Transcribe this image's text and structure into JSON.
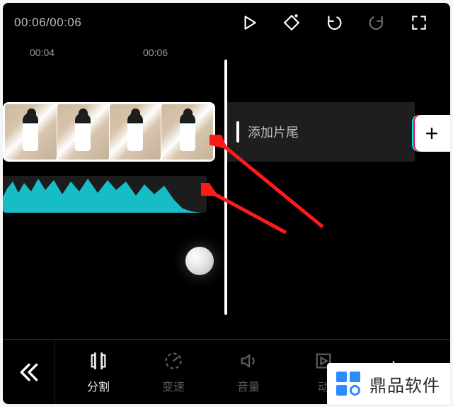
{
  "topbar": {
    "time_current": "00:06",
    "time_total": "00:06"
  },
  "ruler": {
    "marks": [
      "00:04",
      "00:06"
    ]
  },
  "end_slate": {
    "label": "添加片尾"
  },
  "add_button": {
    "glyph": "+"
  },
  "toolbar": {
    "split": "分割",
    "speed": "变速",
    "volume": "音量",
    "anim": "动",
    "crop": ""
  },
  "watermark": {
    "text": "鼎品软件"
  }
}
